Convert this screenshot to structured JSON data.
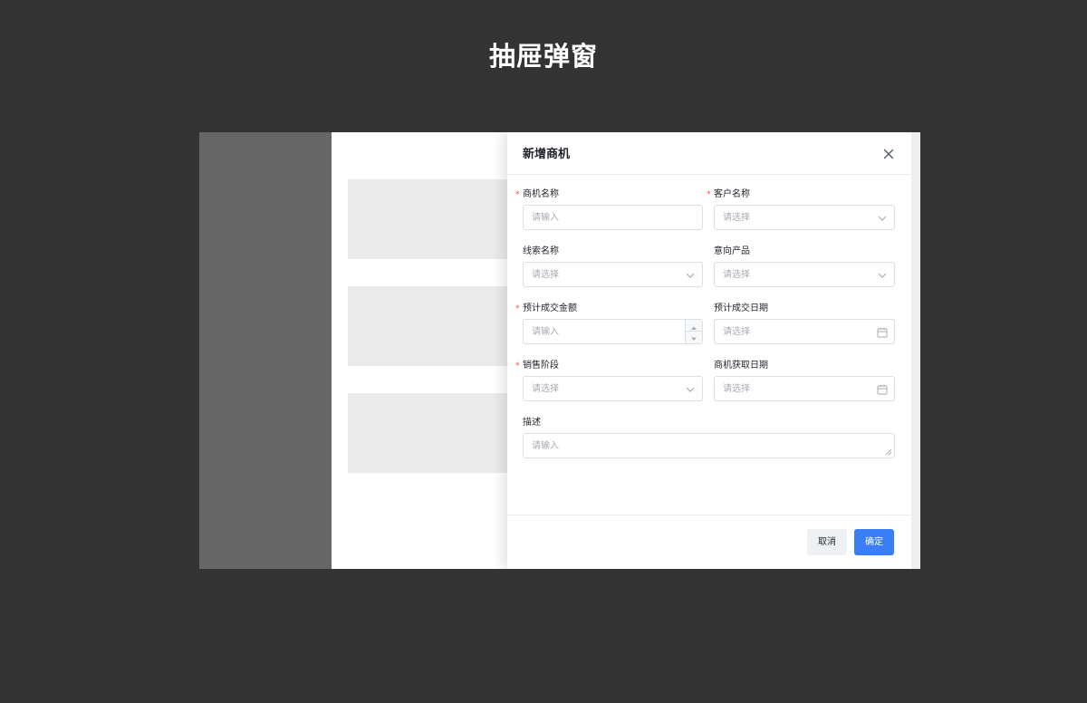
{
  "page": {
    "title": "抽屉弹窗"
  },
  "drawer": {
    "title": "新增商机",
    "close_icon": "close-icon"
  },
  "form": {
    "fields": [
      {
        "label": "商机名称",
        "required": true,
        "placeholder": "请输入",
        "type": "input"
      },
      {
        "label": "客户名称",
        "required": true,
        "placeholder": "请选择",
        "type": "select"
      },
      {
        "label": "线索名称",
        "required": false,
        "placeholder": "请选择",
        "type": "select"
      },
      {
        "label": "意向产品",
        "required": false,
        "placeholder": "请选择",
        "type": "select"
      },
      {
        "label": "预计成交金额",
        "required": true,
        "placeholder": "请输入",
        "type": "number"
      },
      {
        "label": "预计成交日期",
        "required": false,
        "placeholder": "请选择",
        "type": "date"
      },
      {
        "label": "销售阶段",
        "required": true,
        "placeholder": "请选择",
        "type": "select"
      },
      {
        "label": "商机获取日期",
        "required": false,
        "placeholder": "请选择",
        "type": "date"
      },
      {
        "label": "描述",
        "required": false,
        "placeholder": "请输入",
        "type": "textarea"
      }
    ],
    "required_mark": "*"
  },
  "footer": {
    "cancel_label": "取消",
    "confirm_label": "确定"
  },
  "colors": {
    "background": "#333333",
    "sidebar": "#666666",
    "placeholder_block": "#ebebeb",
    "primary": "#3a7ef6",
    "required": "#f54a45"
  }
}
